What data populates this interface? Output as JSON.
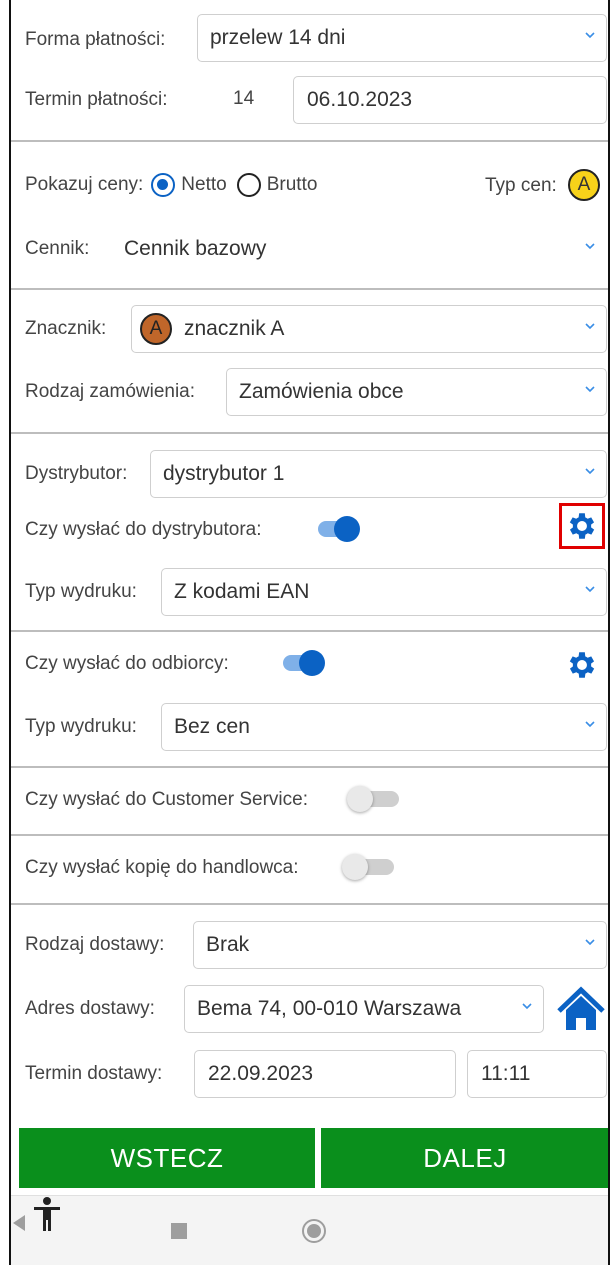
{
  "payment": {
    "form_label": "Forma płatności:",
    "form_value": "przelew 14 dni",
    "term_label": "Termin płatności:",
    "term_days": "14",
    "term_date": "06.10.2023"
  },
  "prices": {
    "show_label": "Pokazuj ceny:",
    "netto_label": "Netto",
    "brutto_label": "Brutto",
    "selected": "Netto",
    "price_type_label": "Typ cen:",
    "price_type_badge": "A",
    "pricelist_label": "Cennik:",
    "pricelist_value": "Cennik bazowy"
  },
  "marker": {
    "label": "Znacznik:",
    "badge": "A",
    "value": "znacznik A",
    "order_type_label": "Rodzaj zamówienia:",
    "order_type_value": "Zamówienia obce"
  },
  "distributor": {
    "label": "Dystrybutor:",
    "value": "dystrybutor 1",
    "send_label": "Czy wysłać do dystrybutora:",
    "send_on": true,
    "print_label": "Typ wydruku:",
    "print_value": "Z kodami EAN"
  },
  "recipient": {
    "send_label": "Czy wysłać do odbiorcy:",
    "send_on": true,
    "print_label": "Typ wydruku:",
    "print_value": "Bez cen"
  },
  "customer_service": {
    "send_label": "Czy wysłać do Customer Service:",
    "send_on": false
  },
  "salesperson": {
    "send_label": "Czy wysłać kopię do handlowca:",
    "send_on": false
  },
  "delivery": {
    "type_label": "Rodzaj dostawy:",
    "type_value": "Brak",
    "address_label": "Adres dostawy:",
    "address_value": "Bema 74, 00-010 Warszawa",
    "date_label": "Termin dostawy:",
    "date_value": "22.09.2023",
    "time_value": "11:11"
  },
  "buttons": {
    "back": "WSTECZ",
    "next": "DALEJ"
  },
  "colors": {
    "accent": "#0b62c4",
    "green": "#0a8f1c",
    "badge_yellow": "#f7d21a",
    "badge_brown": "#c0662a",
    "highlight": "#e00000"
  },
  "icons": [
    "chevron-down-icon",
    "gear-icon",
    "home-icon",
    "square-nav-icon",
    "circle-nav-icon",
    "back-triangle-icon",
    "accessibility-icon"
  ]
}
